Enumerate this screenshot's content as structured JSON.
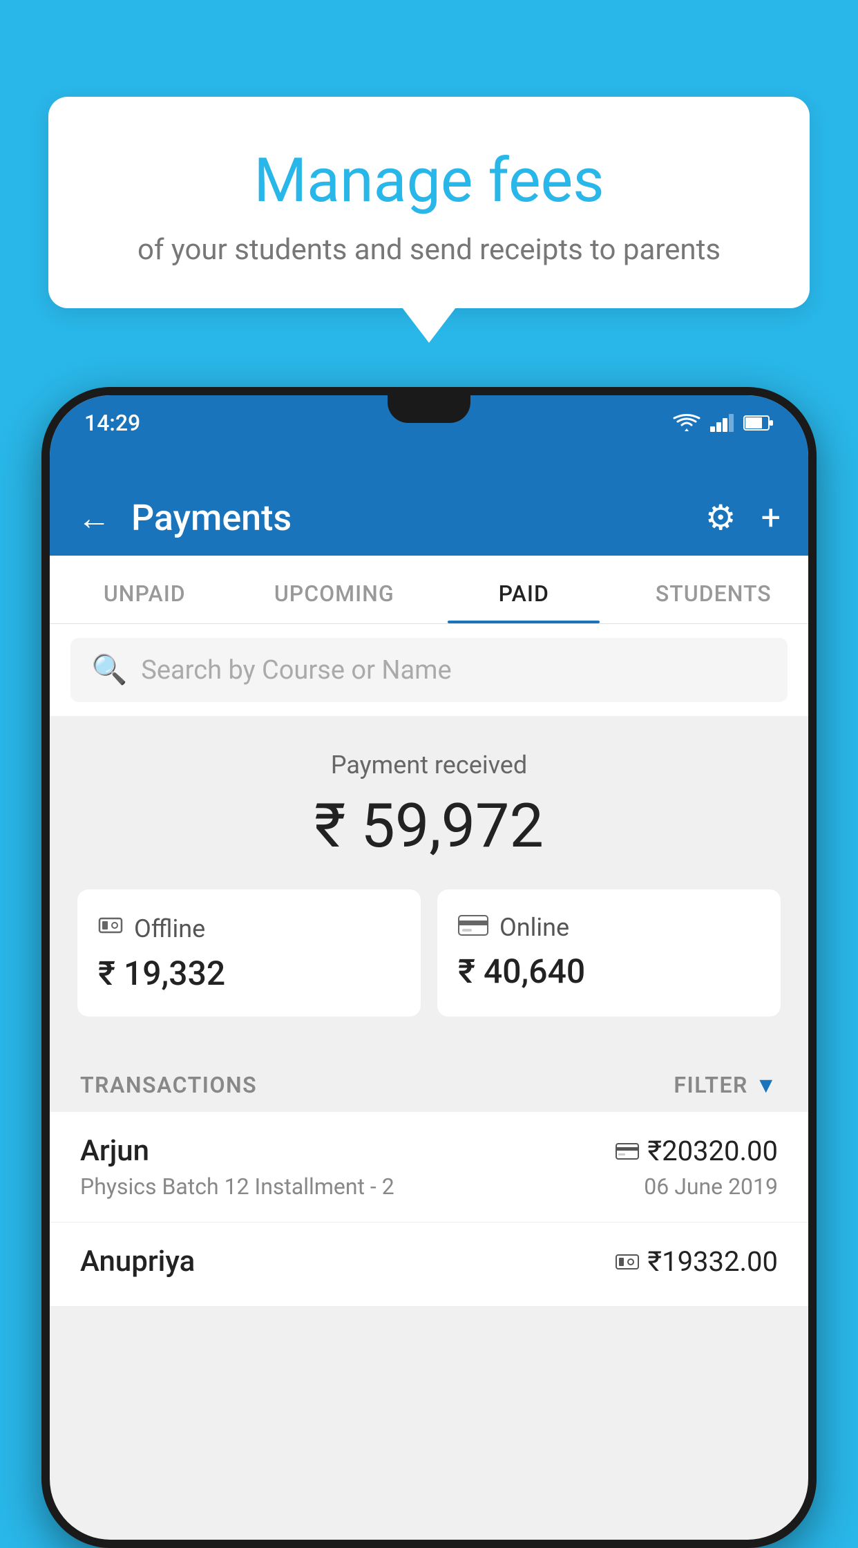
{
  "background_color": "#29B6E8",
  "bubble": {
    "title": "Manage fees",
    "subtitle": "of your students and send receipts to parents"
  },
  "status_bar": {
    "time": "14:29",
    "wifi": "wifi",
    "signal": "signal",
    "battery": "battery"
  },
  "header": {
    "title": "Payments",
    "back_label": "←",
    "gear_label": "⚙",
    "plus_label": "+"
  },
  "tabs": [
    {
      "label": "UNPAID",
      "active": false
    },
    {
      "label": "UPCOMING",
      "active": false
    },
    {
      "label": "PAID",
      "active": true
    },
    {
      "label": "STUDENTS",
      "active": false
    }
  ],
  "search": {
    "placeholder": "Search by Course or Name"
  },
  "payment_summary": {
    "label": "Payment received",
    "amount": "₹ 59,972",
    "offline": {
      "type": "Offline",
      "amount": "₹ 19,332"
    },
    "online": {
      "type": "Online",
      "amount": "₹ 40,640"
    }
  },
  "transactions_section": {
    "label": "TRANSACTIONS",
    "filter_label": "FILTER"
  },
  "transactions": [
    {
      "name": "Arjun",
      "course": "Physics Batch 12 Installment - 2",
      "amount": "₹20320.00",
      "date": "06 June 2019",
      "payment_type": "online"
    },
    {
      "name": "Anupriya",
      "course": "",
      "amount": "₹19332.00",
      "date": "",
      "payment_type": "offline"
    }
  ]
}
